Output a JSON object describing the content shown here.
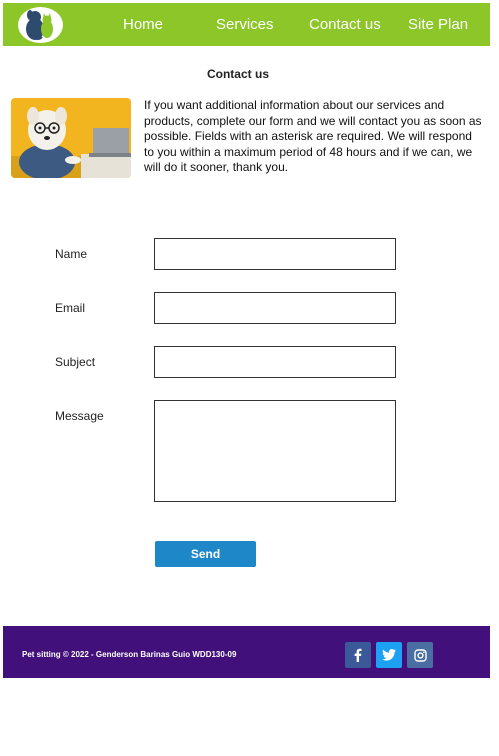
{
  "nav": {
    "items": [
      {
        "label": "Home"
      },
      {
        "label": "Services"
      },
      {
        "label": "Contact us"
      },
      {
        "label": "Site Plan"
      }
    ]
  },
  "page": {
    "title": "Contact us",
    "intro": "If you want additional information about our services and products, complete our form and we will contact you as soon as possible. Fields with an asterisk are required. We will respond to you within a maximum period of 48 hours and if we can, we will do it sooner, thank you."
  },
  "form": {
    "fields": [
      {
        "label": "Name",
        "value": ""
      },
      {
        "label": "Email",
        "value": ""
      },
      {
        "label": "Subject",
        "value": ""
      },
      {
        "label": "Message",
        "value": ""
      }
    ],
    "submit_label": "Send"
  },
  "footer": {
    "text": "Pet sitting © 2022 - Genderson Barinas Guio WDD130-09",
    "social": [
      {
        "icon": "facebook-icon"
      },
      {
        "icon": "twitter-icon"
      },
      {
        "icon": "instagram-icon"
      }
    ]
  },
  "colors": {
    "header_bg": "#8dc628",
    "footer_bg": "#42107a",
    "button_bg": "#1e87c8"
  }
}
